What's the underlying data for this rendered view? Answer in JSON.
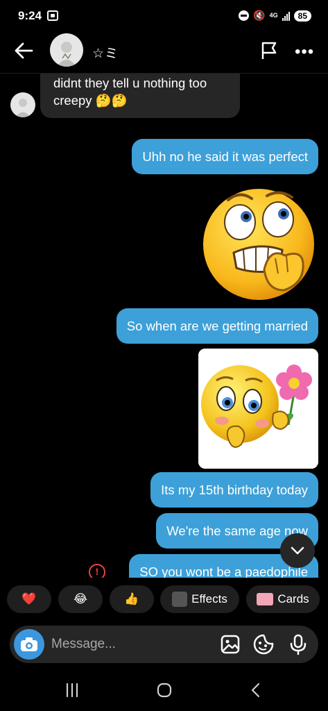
{
  "status_bar": {
    "time": "9:24",
    "network": "4G",
    "battery": "85"
  },
  "header": {
    "contact_name": "☆ミ"
  },
  "messages": {
    "incoming_1": "didnt they tell u nothing too creepy 🤔🤔",
    "outgoing_1": "Uhh no he said it was perfect",
    "outgoing_2": "So when are we getting married",
    "outgoing_3": "Its my 15th birthday today",
    "outgoing_4": "We're the same age now",
    "outgoing_5": "SO you wont be a paedophile"
  },
  "error_icon_glyph": "!",
  "quick_reactions": {
    "heart": "❤️",
    "laugh": "😂",
    "thumbs_up": "👍",
    "effects_label": "Effects",
    "cards_label": "Cards"
  },
  "composer": {
    "placeholder": "Message..."
  },
  "colors": {
    "outgoing_bubble": "#3da0d8",
    "incoming_bubble": "#262626",
    "camera_button": "#3d97de",
    "error": "#e8453c"
  },
  "icons": [
    "back-icon",
    "flag-icon",
    "more-icon",
    "camera-icon",
    "gallery-icon",
    "sticker-icon",
    "microphone-icon",
    "chevron-down-icon",
    "error-icon",
    "recents-icon",
    "home-icon",
    "nav-back-icon"
  ]
}
